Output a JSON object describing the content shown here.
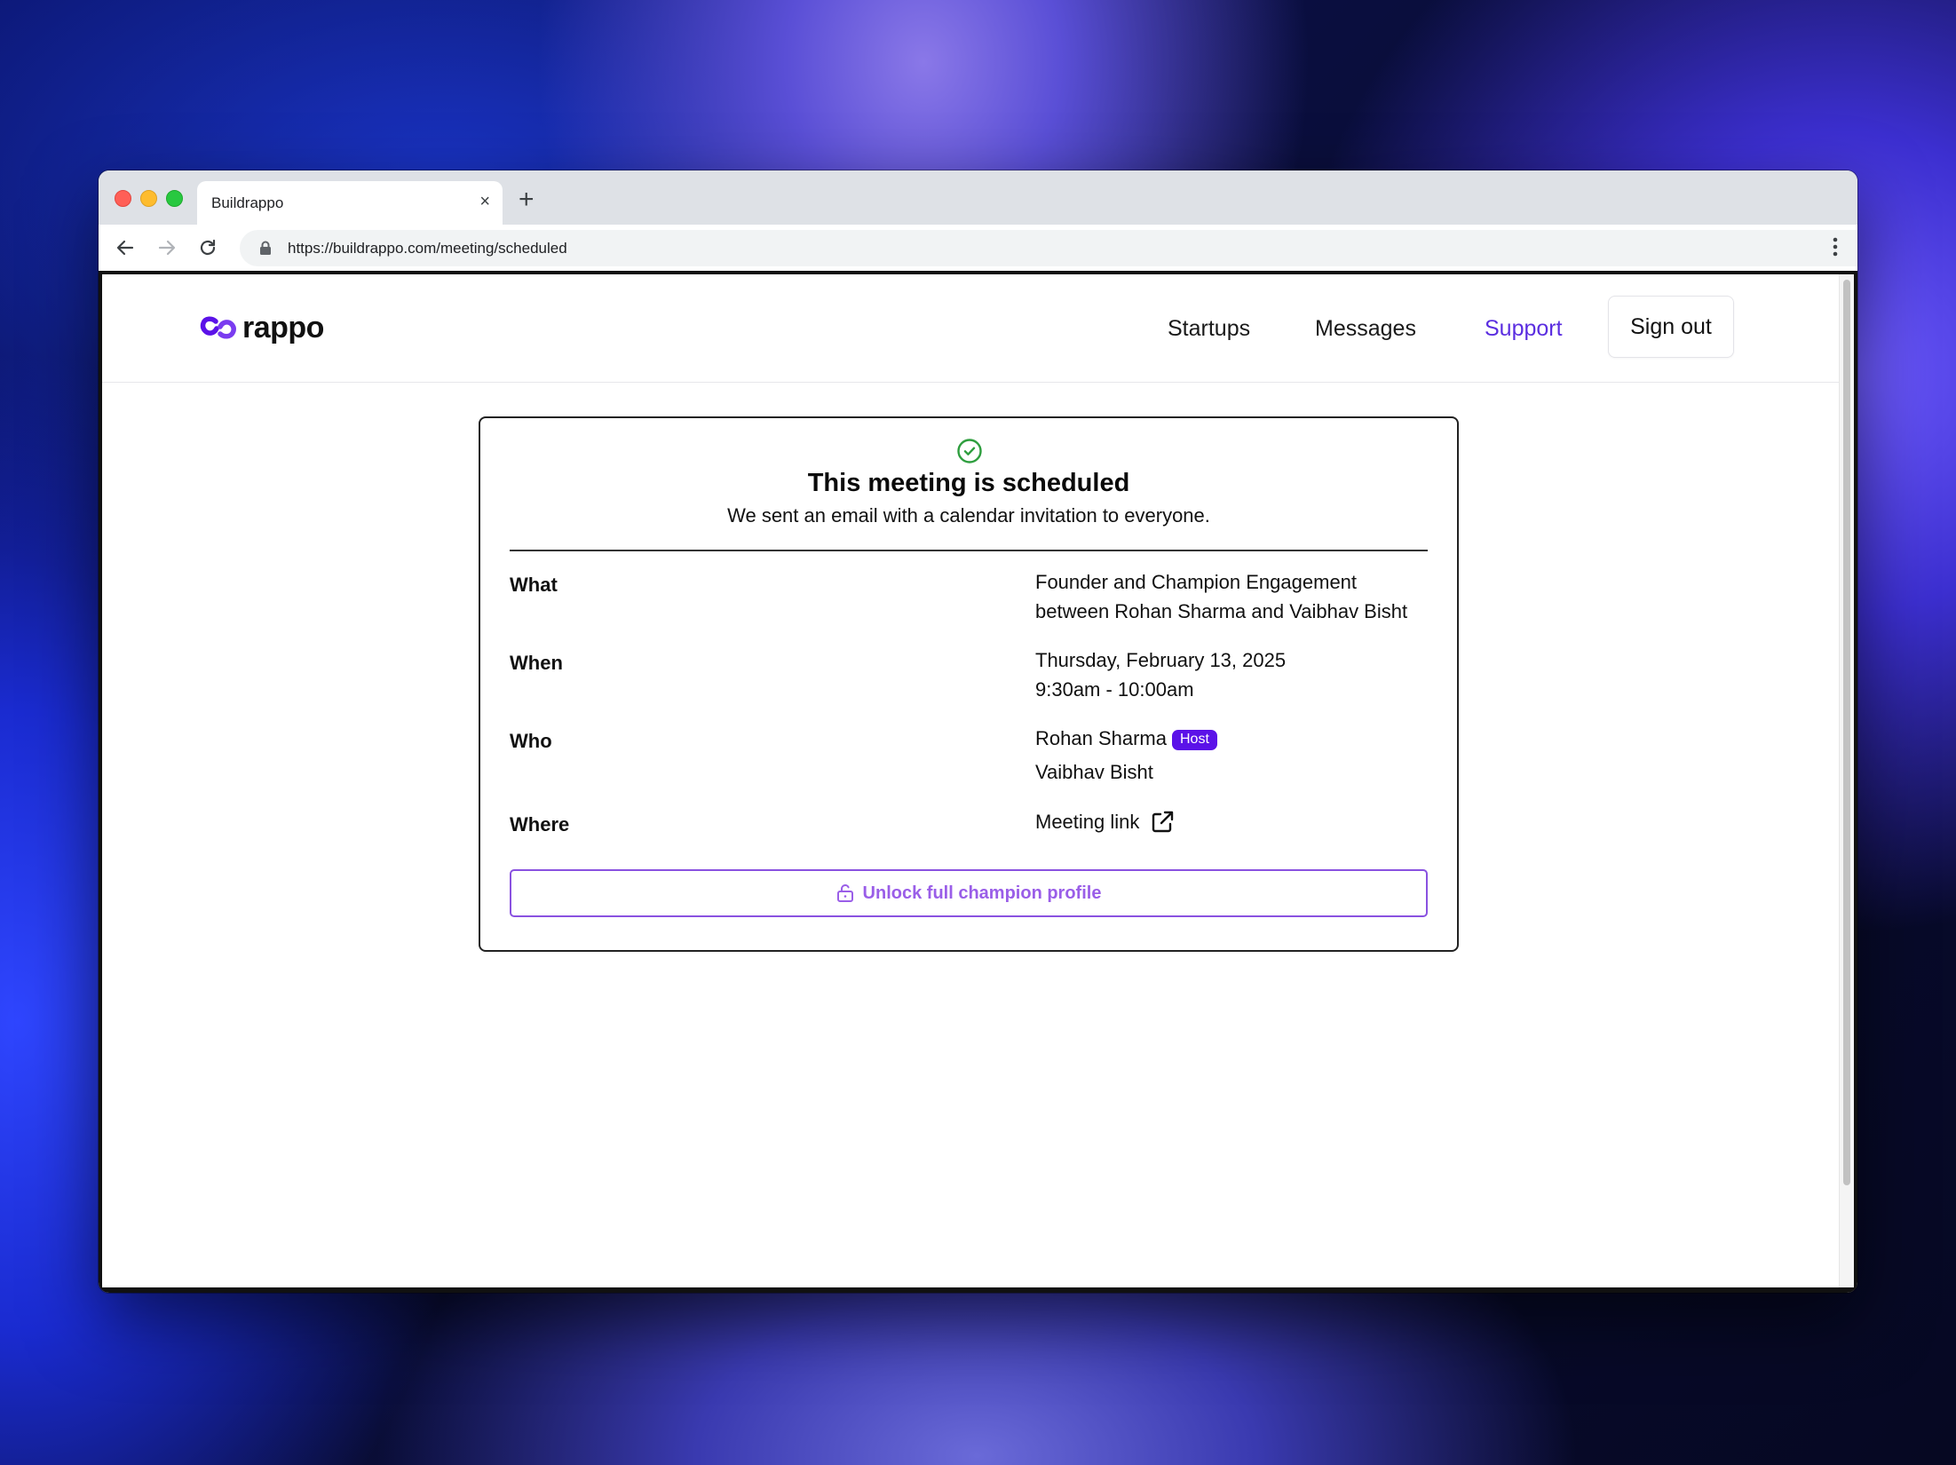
{
  "browser": {
    "tab_title": "Buildrappo",
    "tab_close": "×",
    "new_tab": "+",
    "url": "https://buildrappo.com/meeting/scheduled"
  },
  "app": {
    "logo_text": "rappo",
    "nav": {
      "startups": "Startups",
      "messages": "Messages",
      "support": "Support",
      "sign_out": "Sign out"
    },
    "accent_color": "#5b2ee0"
  },
  "confirmation": {
    "title": "This meeting is scheduled",
    "subtitle": "We sent an email with a calendar invitation to everyone.",
    "rows": {
      "what": {
        "label": "What",
        "line1": "Founder and Champion Engagement",
        "line2": "between Rohan Sharma and Vaibhav Bisht"
      },
      "when": {
        "label": "When",
        "date": "Thursday, February 13, 2025",
        "time": "9:30am - 10:00am"
      },
      "who": {
        "label": "Who",
        "host_name": "Rohan Sharma",
        "host_badge": "Host",
        "guest_name": "Vaibhav Bisht"
      },
      "where": {
        "label": "Where",
        "link_text": "Meeting link"
      }
    },
    "unlock_button": "Unlock full champion profile",
    "success_color": "#2e9e3e",
    "button_color": "#8a52e0"
  }
}
